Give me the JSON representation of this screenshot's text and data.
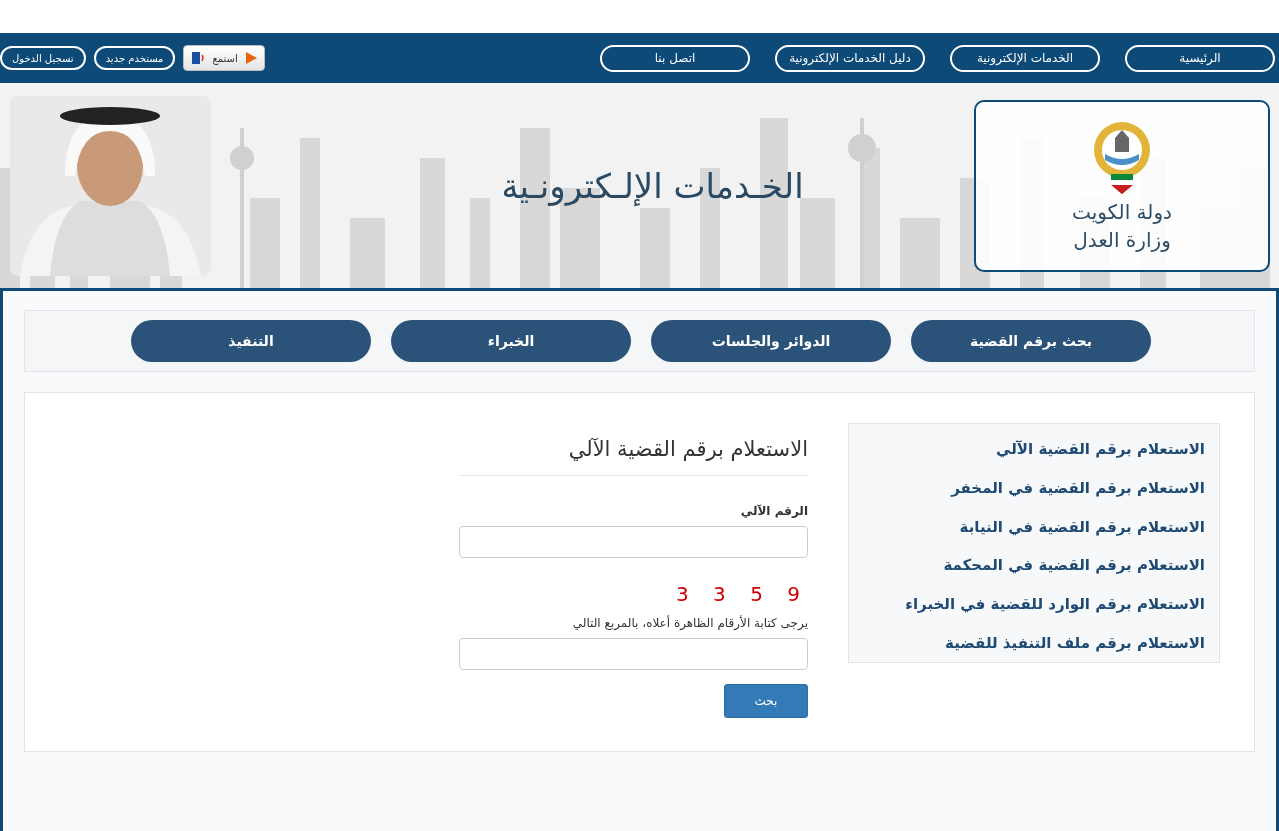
{
  "nav": {
    "links": [
      "الرئيسية",
      "الخدمات الإلكترونية",
      "دليل الخدمات الإلكترونية",
      "اتصل بنا"
    ],
    "listen": {
      "label": "استمع"
    },
    "account_buttons": [
      "مستخدم جديد",
      "تسجيل الدخول"
    ]
  },
  "banner": {
    "ministry_lines": [
      "دولة الكويت",
      "وزارة العدل"
    ],
    "title": "الخـدمات الإلـكترونـية"
  },
  "category_tabs": [
    "بحث برقم القضية",
    "الدوائر والجلسات",
    "الخبراء",
    "التنفيذ"
  ],
  "inquiry_menu": [
    "الاستعلام برقم القضية الآلي",
    "الاستعلام برقم القضية في المخفر",
    "الاستعلام برقم القضية في النيابة",
    "الاستعلام برقم القضية في المحكمة",
    "الاستعلام برقم الوارد للقضية في الخبراء",
    "الاستعلام برقم ملف التنفيذ للقضية"
  ],
  "form": {
    "heading": "الاستعلام برقم القضية الآلي",
    "field_label": "الرقم الآلي",
    "captcha_code": "3 3 5 9",
    "captcha_hint": "يرجى كتابة الأرقام الظاهرة أعلاه، بالمربع التالي",
    "submit": "بحث"
  }
}
